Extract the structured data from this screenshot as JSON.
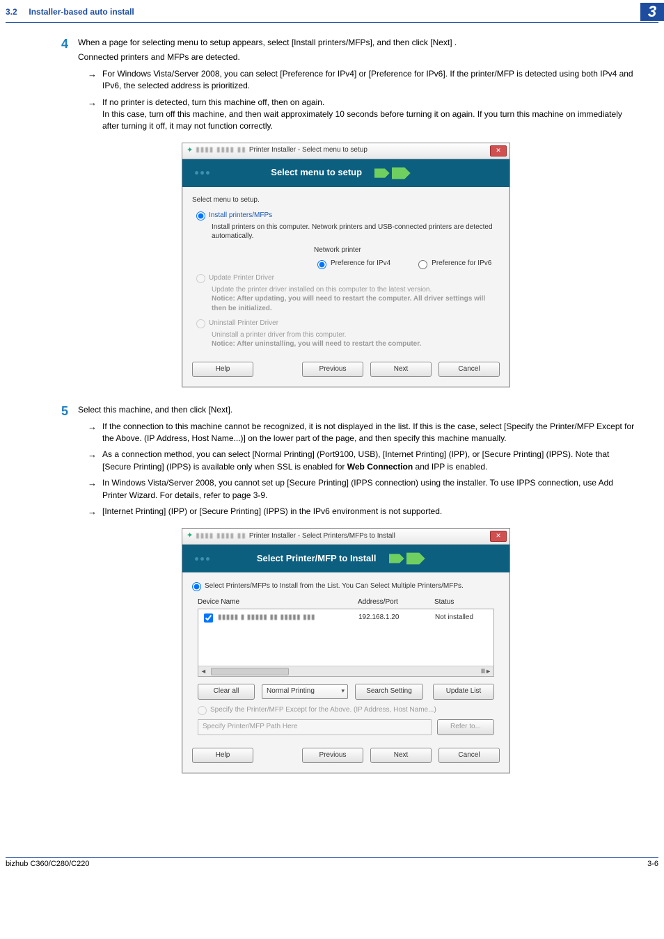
{
  "header": {
    "section_number": "3.2",
    "section_title": "Installer-based auto install",
    "chapter_badge": "3"
  },
  "steps": {
    "s4": {
      "num": "4",
      "line1": "When a page for selecting menu to setup appears, select [Install printers/MFPs], and then click [Next] .",
      "line2": "Connected printers and MFPs are detected.",
      "b1": "For Windows Vista/Server 2008, you can select [Preference for IPv4] or [Preference for IPv6]. If the printer/MFP is detected using both IPv4 and IPv6, the selected address is prioritized.",
      "b2a": "If no printer is detected, turn this machine off, then on again.",
      "b2b": "In this case, turn off this machine, and then wait approximately 10 seconds before turning it on again. If you turn this machine on immediately after turning it off, it may not function correctly."
    },
    "s5": {
      "num": "5",
      "line1": "Select this machine, and then click [Next].",
      "b1": "If the connection to this machine cannot be recognized, it is not displayed in the list. If this is the case, select [Specify the Printer/MFP Except for the Above. (IP Address, Host Name...)] on the lower part of the page, and then specify this machine manually.",
      "b2_pre": "As a connection method, you can select [Normal Printing] (Port9100, USB), [Internet Printing] (IPP), or [Secure Printing] (IPPS). Note that [Secure Printing] (IPPS)  is available only when SSL is enabled for ",
      "b2_bold": "Web Connection",
      "b2_post": " and IPP is enabled.",
      "b3": "In Windows Vista/Server 2008, you cannot set up [Secure Printing] (IPPS connection) using the installer. To use IPPS connection, use Add Printer Wizard. For details, refer to page 3-9.",
      "b4": "[Internet Printing] (IPP) or [Secure Printing] (IPPS) in the IPv6 environment is not supported."
    }
  },
  "dialog1": {
    "title": "Printer Installer - Select menu to setup",
    "banner": "Select menu to setup",
    "select_label": "Select menu to setup.",
    "opt1": "Install printers/MFPs",
    "opt1_desc": "Install printers on this computer. Network printers and USB-connected printers are detected automatically.",
    "np_label": "Network printer",
    "np_v4": "Preference for IPv4",
    "np_v6": "Preference for IPv6",
    "opt2": "Update Printer Driver",
    "opt2_desc1": "Update the printer driver installed on this computer to the latest version.",
    "opt2_desc2": "Notice: After updating, you will need to restart the computer. All driver settings will then be initialized.",
    "opt3": "Uninstall Printer Driver",
    "opt3_desc1": "Uninstall a printer driver from this computer.",
    "opt3_desc2": "Notice: After uninstalling, you will need to restart the computer.",
    "help": "Help",
    "prev": "Previous",
    "next": "Next",
    "cancel": "Cancel"
  },
  "dialog2": {
    "title": "Printer Installer - Select Printers/MFPs to Install",
    "banner": "Select Printer/MFP to Install",
    "radio_top": "Select Printers/MFPs to Install from the List. You Can Select Multiple Printers/MFPs.",
    "col1": "Device Name",
    "col2": "Address/Port",
    "col3": "Status",
    "row_addr": "192.168.1.20",
    "row_status": "Not installed",
    "clear_all": "Clear all",
    "combo": "Normal Printing",
    "search": "Search Setting",
    "update": "Update List",
    "radio_bottom": "Specify the Printer/MFP Except for the Above. (IP Address, Host Name...)",
    "path_placeholder": "Specify Printer/MFP Path Here",
    "refer": "Refer to...",
    "help": "Help",
    "prev": "Previous",
    "next": "Next",
    "cancel": "Cancel"
  },
  "footer": {
    "left": "bizhub C360/C280/C220",
    "right": "3-6"
  }
}
